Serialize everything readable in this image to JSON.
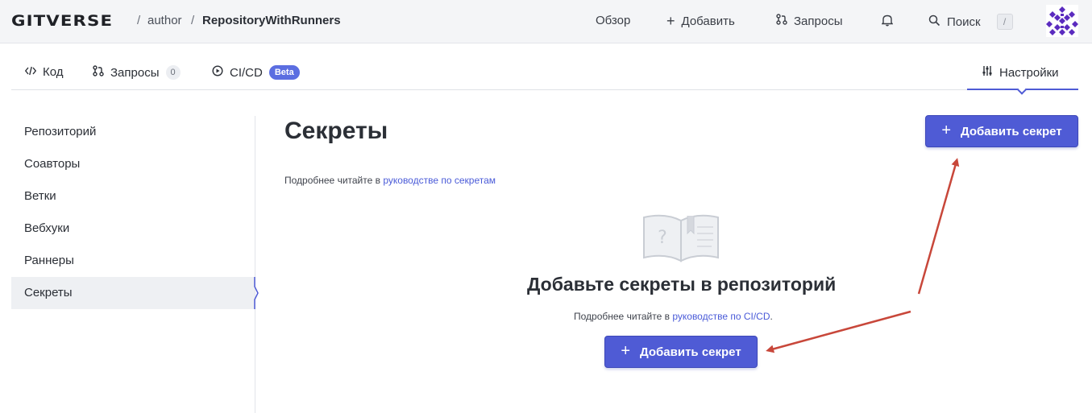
{
  "header": {
    "logo": "GITVERSE",
    "owner": "author",
    "repo": "RepositoryWithRunners",
    "nav": {
      "overview": "Обзор",
      "add": "Добавить",
      "requests": "Запросы",
      "search": "Поиск",
      "search_shortcut": "/"
    }
  },
  "tabs": {
    "code": "Код",
    "requests": "Запросы",
    "requests_count": "0",
    "cicd": "CI/CD",
    "beta_badge": "Beta",
    "settings": "Настройки"
  },
  "sidebar": {
    "items": [
      {
        "label": "Репозиторий"
      },
      {
        "label": "Соавторы"
      },
      {
        "label": "Ветки"
      },
      {
        "label": "Вебхуки"
      },
      {
        "label": "Раннеры"
      },
      {
        "label": "Секреты"
      }
    ],
    "active": "Секреты"
  },
  "main": {
    "title": "Секреты",
    "add_button": "Добавить секрет",
    "hint_prefix": "Подробнее читайте в ",
    "hint_link": "руководстве по секретам",
    "empty": {
      "title": "Добавьте секреты в репозиторий",
      "hint_prefix": "Подробнее читайте в ",
      "hint_link": "руководстве по CI/CD",
      "hint_suffix": ".",
      "button": "Добавить секрет"
    }
  },
  "colors": {
    "accent": "#4f5bd5",
    "link": "#4a5bd8",
    "annotation_arrow": "#c8473a",
    "header_bg": "#f4f5f7"
  }
}
